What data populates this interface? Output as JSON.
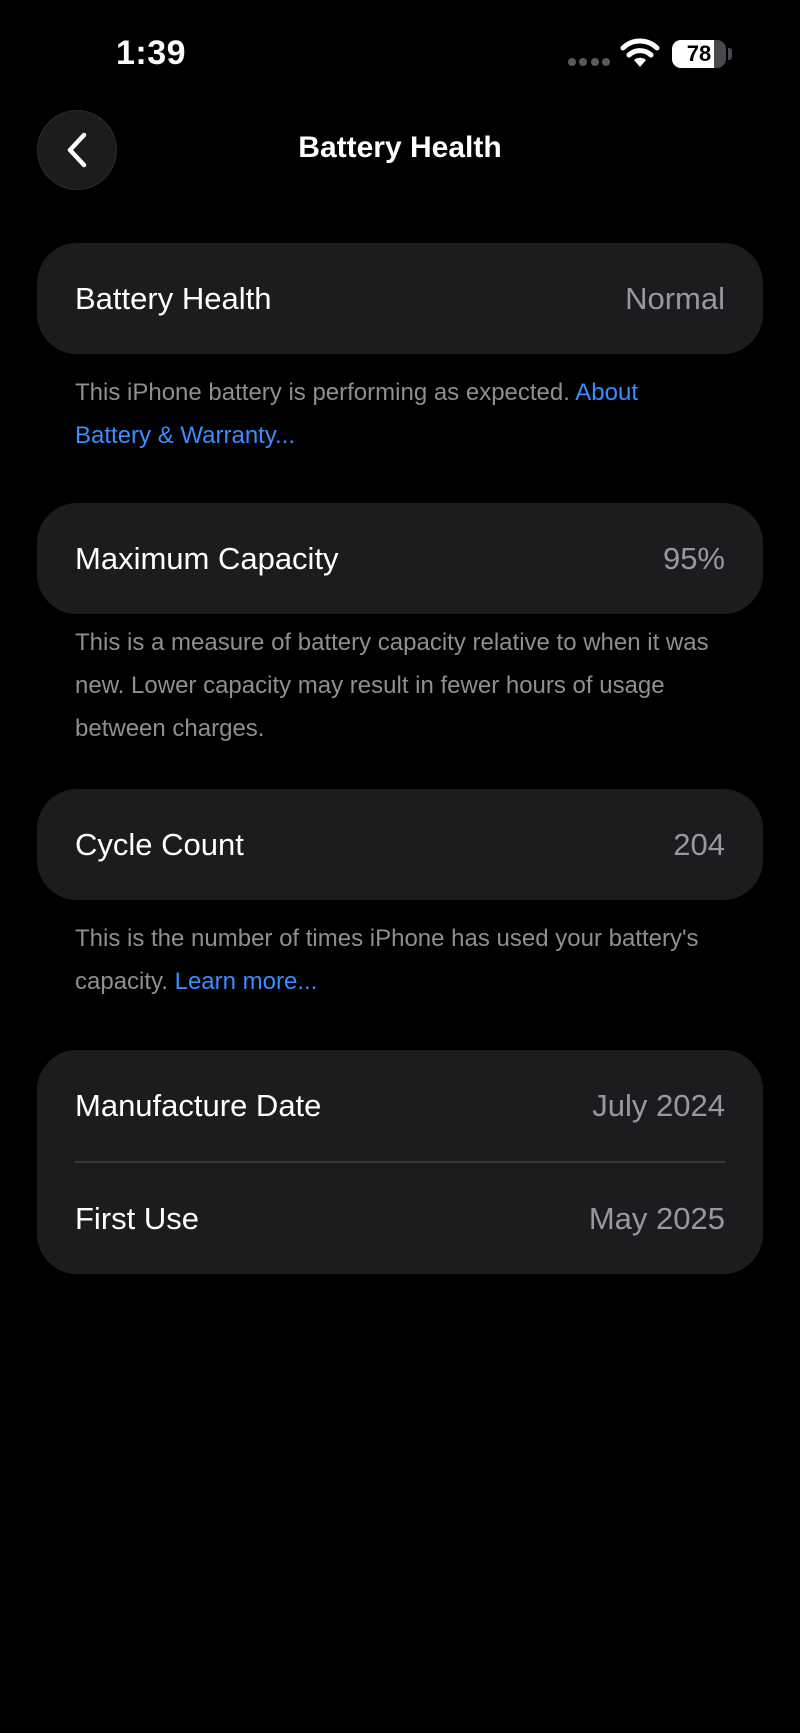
{
  "status_bar": {
    "time": "1:39",
    "battery_level": "78",
    "battery_fraction": 0.78,
    "wifi_icon": "wifi-icon",
    "signal_icon": "cellular-signal-dots-icon"
  },
  "nav": {
    "back_icon": "chevron-left-icon",
    "title": "Battery Health"
  },
  "battery_health": {
    "label": "Battery Health",
    "value": "Normal",
    "footnote_text": "This iPhone battery is performing as expected. ",
    "footnote_link": "About Battery & Warranty..."
  },
  "maximum_capacity": {
    "label": "Maximum Capacity",
    "value": "95%",
    "footnote_text": "This is a measure of battery capacity relative to when it was new. Lower capacity may result in fewer hours of usage between charges."
  },
  "cycle_count": {
    "label": "Cycle Count",
    "value": "204",
    "footnote_text": "This is the number of times iPhone has used your battery's capacity. ",
    "footnote_link": "Learn more..."
  },
  "dates": {
    "manufacture_label": "Manufacture Date",
    "manufacture_value": "July 2024",
    "first_use_label": "First Use",
    "first_use_value": "May 2025"
  },
  "colors": {
    "background": "#000000",
    "card": "#1c1c1e",
    "label": "#ffffff",
    "value": "#98989f",
    "footnote": "#8e8e93",
    "link": "#3a8dff"
  }
}
